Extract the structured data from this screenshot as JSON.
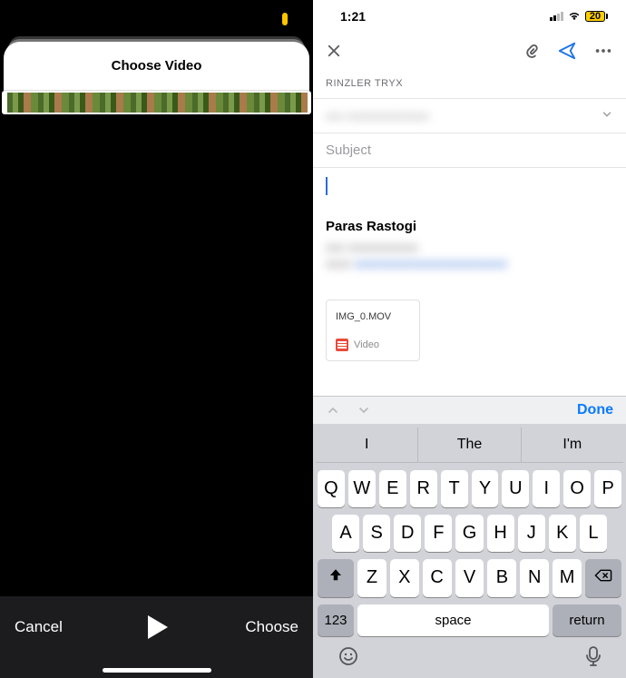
{
  "left": {
    "sheet_title": "Choose Video",
    "cancel": "Cancel",
    "choose": "Choose"
  },
  "right": {
    "status": {
      "time": "1:21",
      "battery": "20"
    },
    "from": "RINZLER TRYX",
    "subject_placeholder": "Subject",
    "signature_name": "Paras Rastogi",
    "attachment": {
      "name": "IMG_0.MOV",
      "kind": "Video"
    },
    "accessory": {
      "done": "Done"
    },
    "suggestions": [
      "I",
      "The",
      "I'm"
    ],
    "keys_r1": [
      "Q",
      "W",
      "E",
      "R",
      "T",
      "Y",
      "U",
      "I",
      "O",
      "P"
    ],
    "keys_r2": [
      "A",
      "S",
      "D",
      "F",
      "G",
      "H",
      "J",
      "K",
      "L"
    ],
    "keys_r3": [
      "Z",
      "X",
      "C",
      "V",
      "B",
      "N",
      "M"
    ],
    "num_key": "123",
    "space_key": "space",
    "return_key": "return"
  }
}
